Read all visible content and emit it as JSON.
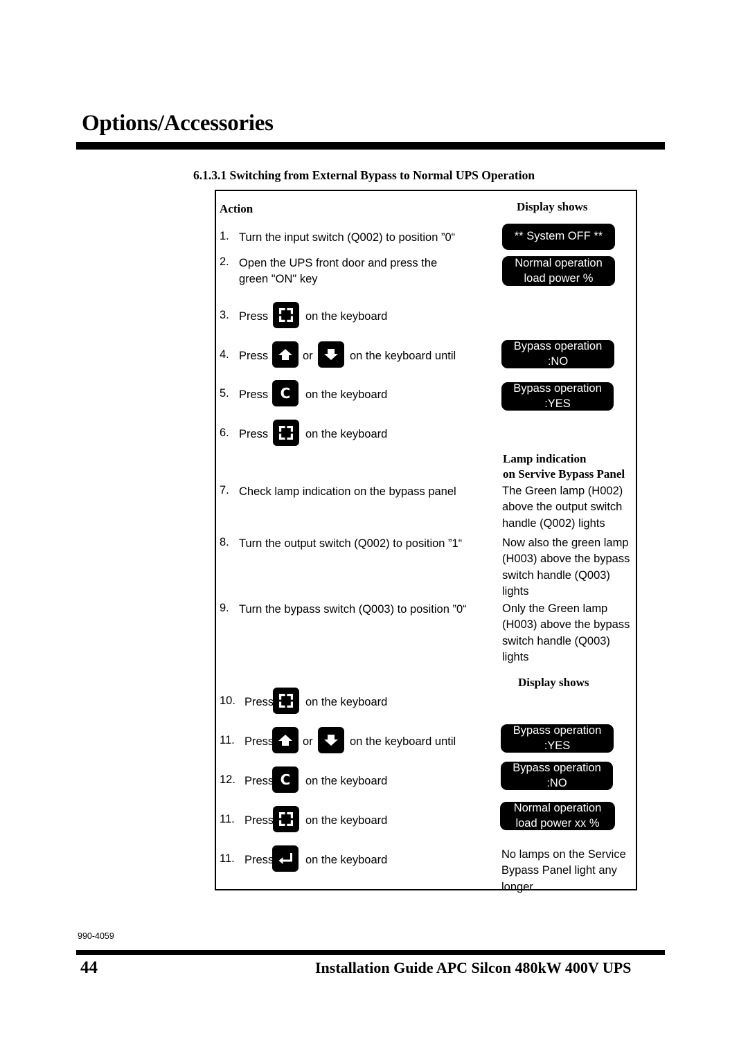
{
  "page": {
    "header_title": "Options/Accessories",
    "section_heading": "6.1.3.1 Switching from External Bypass to Normal UPS Operation",
    "doc_code": "990-4059",
    "page_number": "44",
    "footer_title": "Installation Guide APC Silcon 480kW 400V UPS"
  },
  "table": {
    "headers": {
      "action": "Action",
      "display_shows_1": "Display shows",
      "lamp_indication": "Lamp indication\non Servive Bypass Panel",
      "display_shows_2": "Display shows"
    },
    "steps": [
      {
        "num": "1.",
        "text_before": "Turn the input switch (Q002) to position ”0“",
        "icon": null,
        "text_after": "",
        "icon2": null,
        "between": ""
      },
      {
        "num": "2.",
        "text_before": "Open the UPS front door and press the\ngreen \"ON\" key",
        "icon": null,
        "text_after": "",
        "icon2": null,
        "between": ""
      },
      {
        "num": "3.",
        "text_before": "Press",
        "icon": "display-frame-key-icon",
        "text_after": "on the keyboard",
        "icon2": null,
        "between": ""
      },
      {
        "num": "4.",
        "text_before": "Press",
        "icon": "arrow-up-key-icon",
        "between": "or",
        "icon2": "arrow-down-key-icon",
        "text_after": "on the keyboard until"
      },
      {
        "num": "5.",
        "text_before": "Press",
        "icon": "letter-c-key-icon",
        "text_after": "on the keyboard",
        "icon2": null,
        "between": ""
      },
      {
        "num": "6.",
        "text_before": "Press",
        "icon": "display-frame-key-icon",
        "text_after": "on the keyboard",
        "icon2": null,
        "between": ""
      },
      {
        "num": "7.",
        "text_before": "Check lamp indication on the bypass panel",
        "icon": null,
        "text_after": "",
        "icon2": null,
        "between": ""
      },
      {
        "num": "8.",
        "text_before": "Turn the output switch (Q002) to position ”1“",
        "icon": null,
        "text_after": "",
        "icon2": null,
        "between": ""
      },
      {
        "num": "9.",
        "text_before": "Turn the bypass switch (Q003) to position ”0“",
        "icon": null,
        "text_after": "",
        "icon2": null,
        "between": ""
      },
      {
        "num": "10.",
        "text_before": "Press",
        "icon": "display-frame-key-icon",
        "text_after": "on the keyboard",
        "icon2": null,
        "between": ""
      },
      {
        "num": "11.",
        "text_before": "Press",
        "icon": "arrow-up-key-icon",
        "between": "or",
        "icon2": "arrow-down-key-icon",
        "text_after": "on the keyboard until"
      },
      {
        "num": "12.",
        "text_before": "Press",
        "icon": "letter-c-key-icon",
        "text_after": "on the keyboard",
        "icon2": null,
        "between": ""
      },
      {
        "num": "11.",
        "text_before": "Press",
        "icon": "display-frame-key-icon",
        "text_after": "on the keyboard",
        "icon2": null,
        "between": ""
      },
      {
        "num": "11.",
        "text_before": "Press",
        "icon": "enter-key-icon",
        "text_after": "on the keyboard",
        "icon2": null,
        "between": ""
      }
    ],
    "displays": [
      {
        "line1": "** System OFF **",
        "line2": ""
      },
      {
        "line1": "Normal operation",
        "line2": "load power %"
      },
      {
        "line1": "Bypass operation",
        "line2": ":NO"
      },
      {
        "line1": "Bypass operation",
        "line2": ":YES"
      },
      {
        "line1": "Bypass operation",
        "line2": ":YES"
      },
      {
        "line1": "Bypass operation",
        "line2": ":NO"
      },
      {
        "line1": "Normal operation",
        "line2": "load power xx %"
      }
    ],
    "lamp_notes": [
      "The Green lamp (H002)\nabove the output switch\nhandle (Q002) lights",
      "Now also the green lamp\n(H003) above the bypass\nswitch handle (Q003)\nlights",
      "Only the Green lamp\n(H003) above the bypass\nswitch handle (Q003)\nlights"
    ],
    "final_note": "No lamps on the Service\nBypass Panel light any\nlonger"
  },
  "colors": {
    "ink": "#000000",
    "paper": "#ffffff",
    "lcd_background": "#000000",
    "lcd_text": "#ffffff"
  }
}
